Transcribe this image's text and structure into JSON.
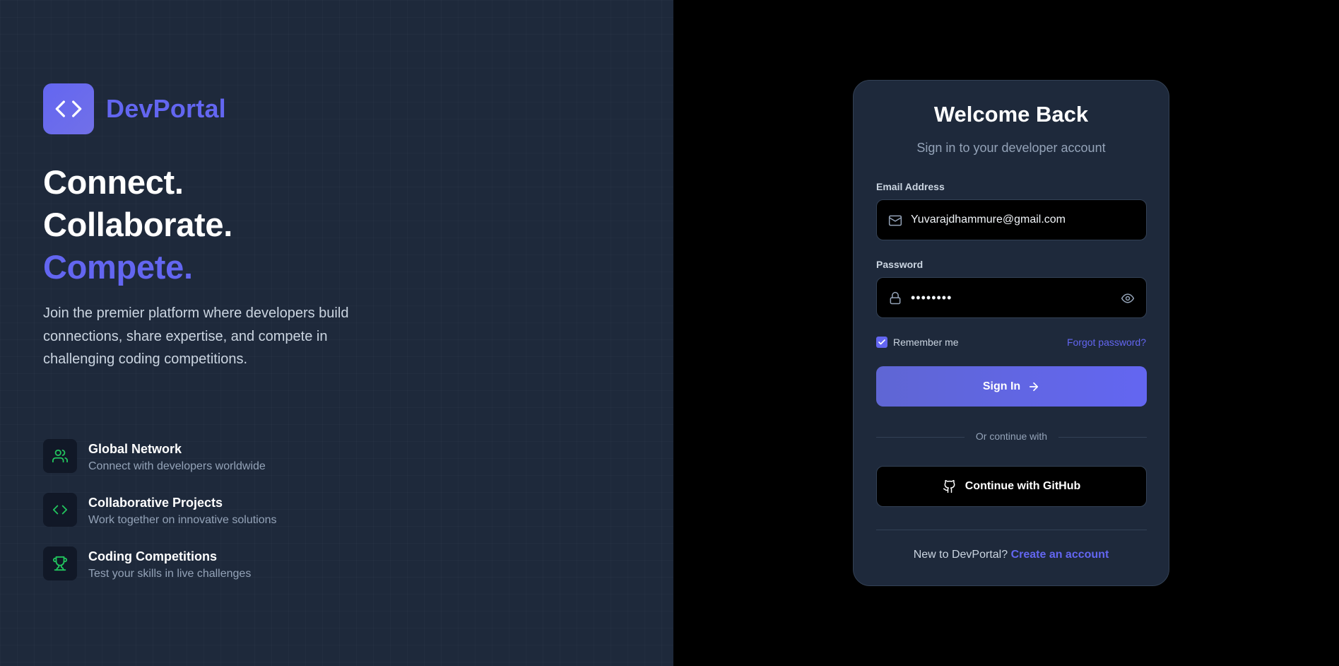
{
  "brand": {
    "name": "DevPortal",
    "logo_icon": "code-icon"
  },
  "hero": {
    "line1": "Connect.",
    "line2": "Collaborate.",
    "line3": "Compete.",
    "description": "Join the premier platform where developers build connections, share expertise, and compete in challenging coding competitions."
  },
  "features": [
    {
      "icon": "users-icon",
      "title": "Global Network",
      "desc": "Connect with developers worldwide"
    },
    {
      "icon": "code-icon",
      "title": "Collaborative Projects",
      "desc": "Work together on innovative solutions"
    },
    {
      "icon": "trophy-icon",
      "title": "Coding Competitions",
      "desc": "Test your skills in live challenges"
    }
  ],
  "login": {
    "title": "Welcome Back",
    "subtitle": "Sign in to your developer account",
    "email_label": "Email Address",
    "email_value": "Yuvarajdhammure@gmail.com",
    "password_label": "Password",
    "password_value": "••••••••",
    "remember_label": "Remember me",
    "remember_checked": true,
    "forgot_label": "Forgot password?",
    "signin_label": "Sign In",
    "divider_text": "Or continue with",
    "github_label": "Continue with GitHub",
    "signup_prompt": "New to DevPortal?",
    "signup_link": "Create an account"
  },
  "colors": {
    "accent": "#6366f1",
    "feature_icon": "#22c55e",
    "left_bg": "#1e293b",
    "right_bg": "#000000"
  }
}
